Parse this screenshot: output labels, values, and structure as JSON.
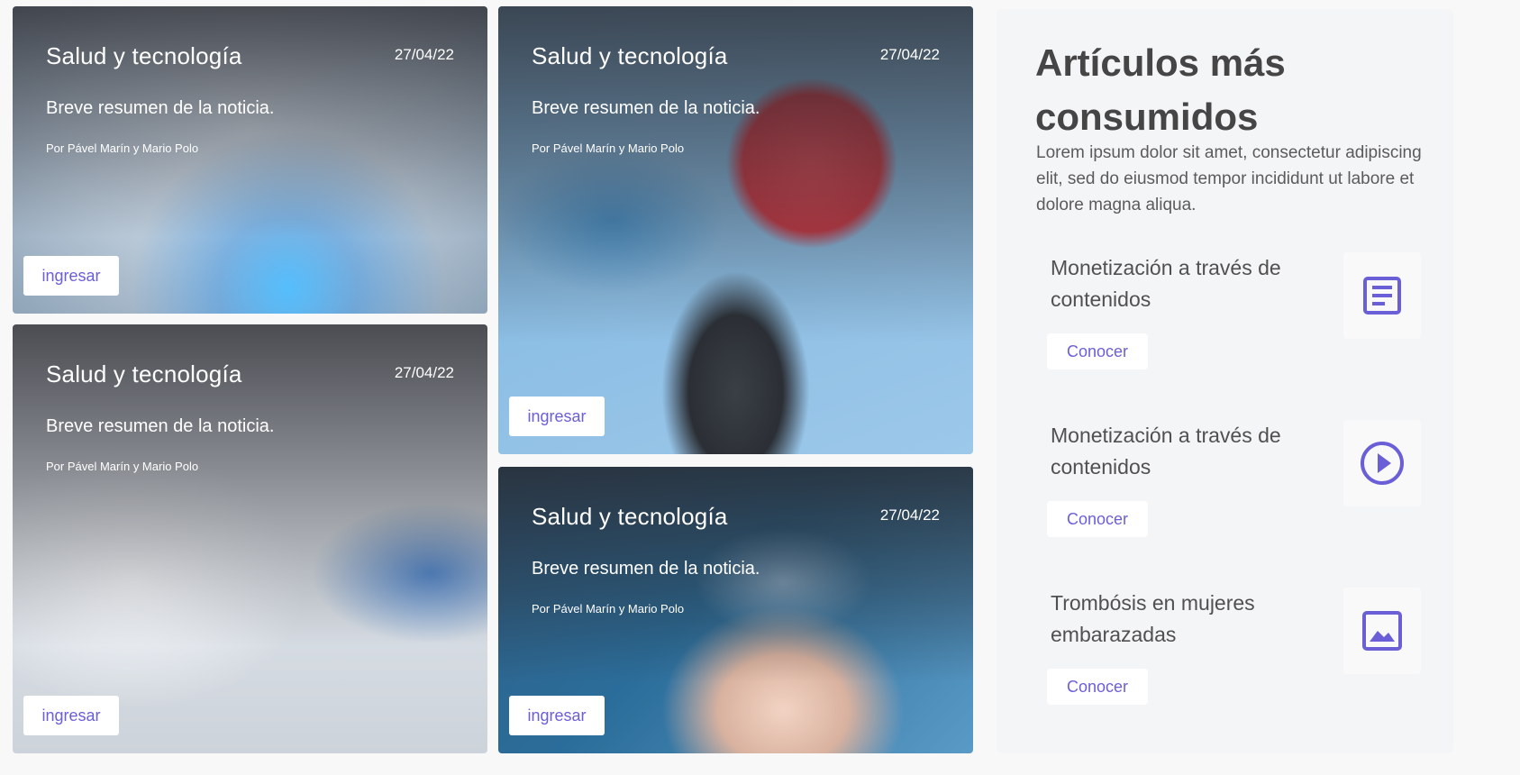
{
  "colors": {
    "accent": "#6b5fd8",
    "heading": "#454545",
    "body_text": "#5b5b5b",
    "sidebar_bg": "#f4f5f7"
  },
  "cards": [
    {
      "title": "Salud y tecnología",
      "date": "27/04/22",
      "summary": "Breve resumen de la noticia.",
      "author": "Por Pável Marín y Mario Polo",
      "button": "ingresar",
      "image": "doctor-stethoscope-hologram"
    },
    {
      "title": "Salud y tecnología",
      "date": "27/04/22",
      "summary": "Breve resumen de la noticia.",
      "author": "Por Pável Marín y Mario Polo",
      "button": "ingresar",
      "image": "lab-pipette"
    },
    {
      "title": "Salud y tecnología",
      "date": "27/04/22",
      "summary": "Breve resumen de la noticia.",
      "author": "Por Pável Marín y Mario Polo",
      "button": "ingresar",
      "image": "donut-glucometer"
    },
    {
      "title": "Salud y tecnología",
      "date": "27/04/22",
      "summary": "Breve resumen de la noticia.",
      "author": "Por Pável Marín y Mario Polo",
      "button": "ingresar",
      "image": "hand-shield-cross"
    }
  ],
  "sidebar": {
    "heading": "Artículos más consumidos",
    "intro": "Lorem ipsum dolor sit amet, consectetur adipiscing elit, sed do eiusmod tempor incididunt ut labore et dolore magna aliqua.",
    "items": [
      {
        "title": "Monetización a través de contenidos",
        "button": "Conocer",
        "icon": "document-icon"
      },
      {
        "title": "Monetización a través de contenidos",
        "button": "Conocer",
        "icon": "play-icon"
      },
      {
        "title": "Trombósis en mujeres embarazadas",
        "button": "Conocer",
        "icon": "image-icon"
      }
    ]
  }
}
